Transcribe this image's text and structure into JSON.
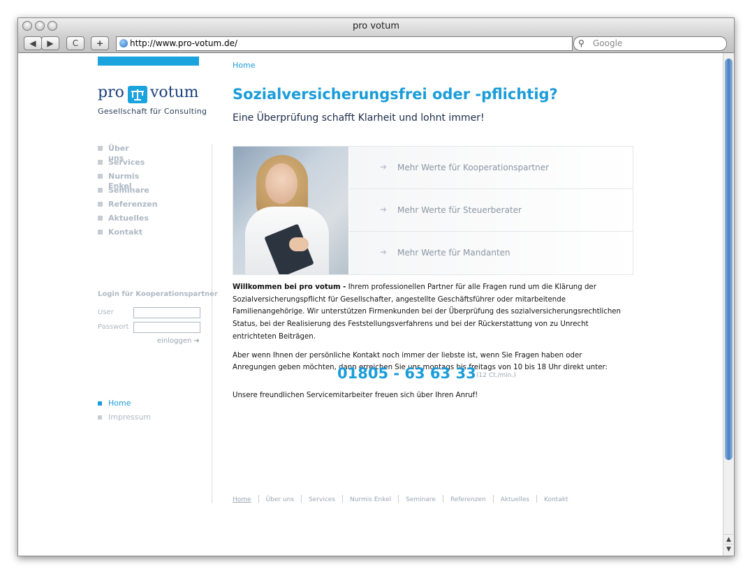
{
  "browser": {
    "window_title": "pro votum",
    "url": "http://www.pro-votum.de/",
    "search_placeholder": "Google",
    "back_label": "◀",
    "forward_label": "▶",
    "reload_label": "C",
    "add_label": "+"
  },
  "site": {
    "breadcrumb": "Home",
    "logo": {
      "left": "pro",
      "right": "votum",
      "tagline": "Gesellschaft für Consulting"
    },
    "headline": "Sozialversicherungsfrei oder -pflichtig?",
    "subheadline": "Eine Überprüfung schafft Klarheit und lohnt immer!",
    "nav": [
      "Über uns",
      "Services",
      "Nurmis Enkel",
      "Seminare",
      "Referenzen",
      "Aktuelles",
      "Kontakt"
    ],
    "login": {
      "title": "Login für Kooperationspartner",
      "user_label": "User",
      "password_label": "Passwort",
      "button": "einloggen ➜"
    },
    "subnav": [
      {
        "label": "Home",
        "color": "#1a9cd9",
        "marker": "#1a9cd9"
      },
      {
        "label": "Impressum",
        "color": "#aeb9c4",
        "marker": "#c6ccd3"
      }
    ],
    "banner_links": [
      "Mehr Werte für Kooperationspartner",
      "Mehr Werte für Steuerberater",
      "Mehr Werte für Mandanten"
    ],
    "intro_bold": "Willkommen bei pro votum -",
    "intro_text": " Ihrem professionellen Partner für alle Fragen rund um die Klärung der Sozialversicherungspflicht für Gesellschafter, angestellte Geschäftsführer oder mitarbeitende Familienangehörige. Wir unterstützen Firmenkunden bei der Überprüfung des sozialversicherungsrechtlichen Status, bei der Realisierung des Feststellungsverfahrens und bei der Rückerstattung von zu Unrecht entrichteten Beiträgen.",
    "contact_text": "Aber wenn Ihnen der persönliche Kontakt noch immer der liebste ist, wenn Sie Fragen haben oder Anregungen geben möchten, dann erreichen Sie uns montags bis freitags von 10 bis 18 Uhr direkt unter:",
    "phone": "01805 - 63 63 33",
    "phone_note": "(12 Ct./min.)",
    "closing": "Unsere freundlichen Servicemitarbeiter freuen sich über Ihren Anruf!",
    "footer": [
      "Home",
      "Über uns",
      "Services",
      "Nurmis Enkel",
      "Seminare",
      "Referenzen",
      "Aktuelles",
      "Kontakt"
    ],
    "colors": {
      "accent": "#1a9cd9",
      "navy": "#1b3f7b",
      "muted": "#aeb9c4"
    }
  }
}
